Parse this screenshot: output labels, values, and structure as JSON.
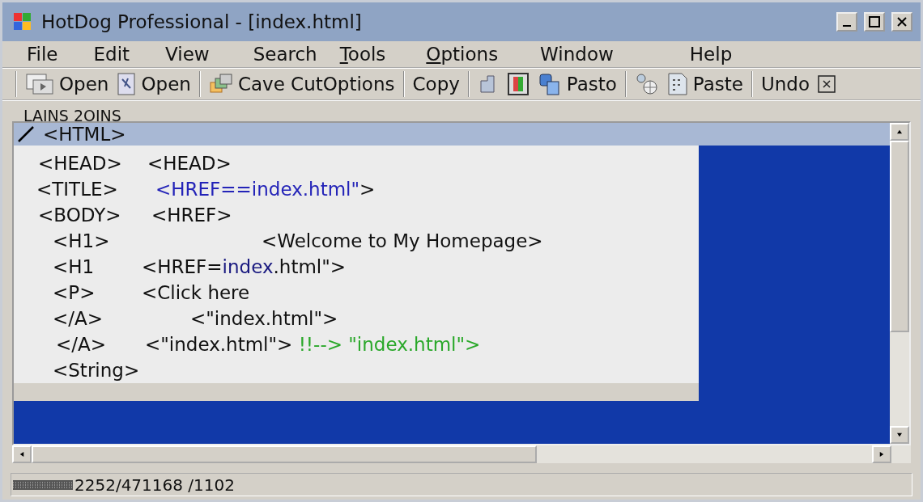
{
  "window": {
    "title": "HotDog Professional - [index.html]"
  },
  "menu": [
    {
      "label": "File",
      "underlined": false
    },
    {
      "label": "Edit",
      "underlined": false
    },
    {
      "label": "View",
      "underlined": false
    },
    {
      "label": "Search",
      "underlined": false
    },
    {
      "label": "Tools",
      "underlined": true
    },
    {
      "label": "Options",
      "underlined": true
    },
    {
      "label": "Window",
      "underlined": false
    },
    {
      "label": "Help",
      "underlined": false
    }
  ],
  "toolbar": [
    {
      "kind": "button",
      "label": "Open"
    },
    {
      "kind": "button",
      "label": "Open"
    },
    {
      "kind": "separator"
    },
    {
      "kind": "button",
      "label": "Cave CutOptions"
    },
    {
      "kind": "separator"
    },
    {
      "kind": "button",
      "label": "Copy"
    },
    {
      "kind": "separator"
    },
    {
      "kind": "icon"
    },
    {
      "kind": "icon"
    },
    {
      "kind": "button",
      "label": "Pasto"
    },
    {
      "kind": "separator"
    },
    {
      "kind": "icon"
    },
    {
      "kind": "button",
      "label": "Paste"
    },
    {
      "kind": "separator"
    },
    {
      "kind": "button",
      "label": "Undo"
    },
    {
      "kind": "close"
    }
  ],
  "ruler": {
    "label": "LAINS 2OINS"
  },
  "editor": {
    "first_line": {
      "text": "<HTML>",
      "selected": true
    },
    "lines": [
      {
        "tag": "<HEAD>",
        "segments": [
          {
            "text": "<HEAD>",
            "kind": "plain"
          }
        ]
      },
      {
        "tag": "<TITLE>",
        "segments": [
          {
            "text": "<HREF==index.html\"",
            "kind": "keyword"
          },
          {
            "text": ">",
            "kind": "plain"
          }
        ]
      },
      {
        "tag": "<BODY>",
        "segments": [
          {
            "text": "<HREF>",
            "kind": "plain"
          }
        ]
      },
      {
        "tag": "<H1>",
        "segments": [
          {
            "text": "<Welcome to My Homepage>",
            "kind": "plain"
          }
        ]
      },
      {
        "tag": "<H1",
        "segments": [
          {
            "text": "<HREF=",
            "kind": "plain"
          },
          {
            "text": "index",
            "kind": "value"
          },
          {
            "text": ".html\">",
            "kind": "plain"
          }
        ]
      },
      {
        "tag": "<P>",
        "segments": [
          {
            "text": "<Click here",
            "kind": "plain"
          }
        ]
      },
      {
        "tag": "</A>",
        "segments": [
          {
            "text": "<\"index.html\">",
            "kind": "plain"
          }
        ]
      },
      {
        "tag": "</A>",
        "segments": [
          {
            "text": "<\"index.html\"> ",
            "kind": "plain"
          },
          {
            "text": "!!--> \"index.html\">",
            "kind": "comment"
          }
        ]
      },
      {
        "tag": "<String>"
      }
    ]
  },
  "status_bar": {
    "text": "2252/471168 /1102"
  }
}
